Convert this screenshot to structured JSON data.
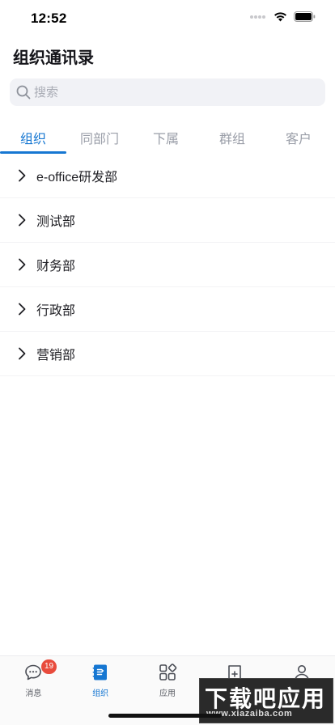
{
  "status_bar": {
    "time": "12:52"
  },
  "header": {
    "title": "组织通讯录"
  },
  "search": {
    "placeholder": "搜索"
  },
  "tabs": [
    {
      "label": "组织",
      "active": true
    },
    {
      "label": "同部门",
      "active": false
    },
    {
      "label": "下属",
      "active": false
    },
    {
      "label": "群组",
      "active": false
    },
    {
      "label": "客户",
      "active": false
    }
  ],
  "departments": [
    {
      "label": "e-office研发部"
    },
    {
      "label": "测试部"
    },
    {
      "label": "财务部"
    },
    {
      "label": "行政部"
    },
    {
      "label": "营销部"
    }
  ],
  "bottom_nav": {
    "items": [
      {
        "label": "消息",
        "icon": "chat-bubble-icon",
        "badge": "19"
      },
      {
        "label": "组织",
        "icon": "contacts-book-icon",
        "active": true
      },
      {
        "label": "应用",
        "icon": "apps-grid-icon"
      },
      {
        "label": "",
        "icon": "document-add-icon"
      },
      {
        "label": "",
        "icon": "person-icon"
      }
    ]
  },
  "watermark": {
    "main": "下载吧应用",
    "sub": "www.xiazaiba.com"
  },
  "colors": {
    "accent": "#1677d2",
    "badge": "#e84b3c",
    "search_bg": "#f1f2f6"
  }
}
